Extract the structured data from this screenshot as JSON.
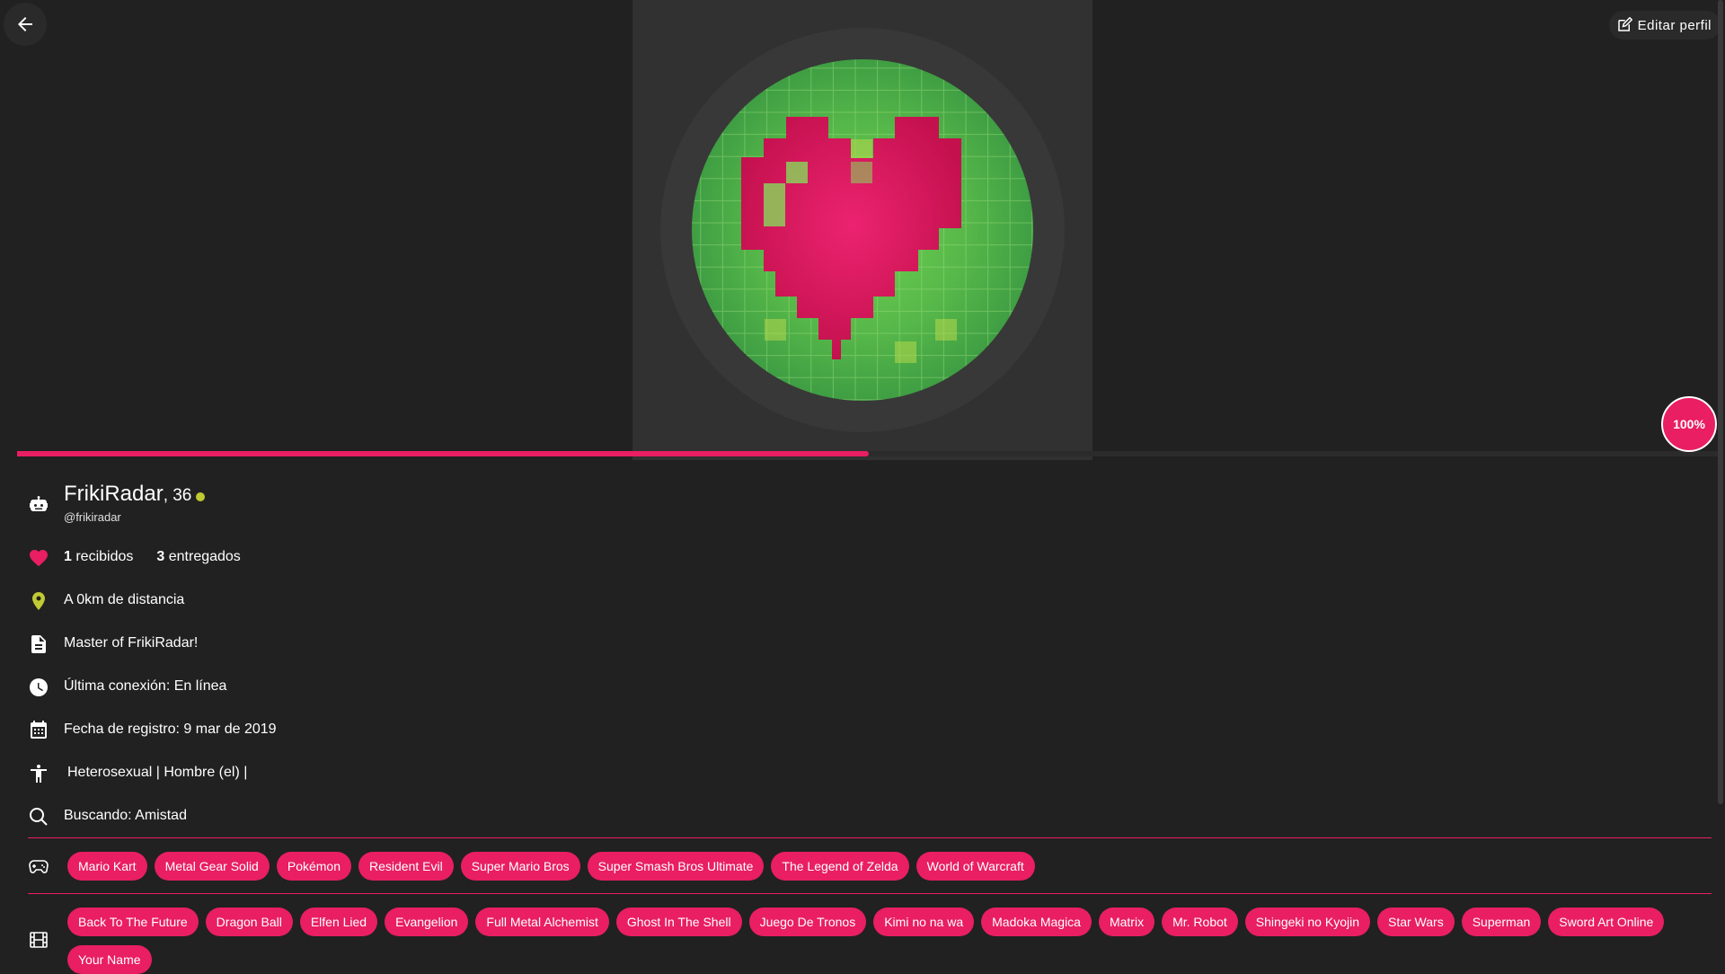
{
  "header": {
    "edit_label": "Editar perfil"
  },
  "profile": {
    "name": "FrikiRadar",
    "age_text": ", 36",
    "handle": "@frikiradar",
    "completion": "100%",
    "completion_value": 0.5
  },
  "stats": {
    "received_count": "1",
    "received_label": " recibidos",
    "given_count": "3",
    "given_label": " entregados"
  },
  "info": {
    "distance": "A 0km de distancia",
    "bio": "Master of FrikiRadar!",
    "last_connection": "Última conexión: En línea",
    "registered": "Fecha de registro: 9 mar de 2019",
    "identity": "Heterosexual |  Hombre (el) |",
    "looking_for": "Buscando: Amistad"
  },
  "games": [
    "Mario Kart",
    "Metal Gear Solid",
    "Pokémon",
    "Resident Evil",
    "Super Mario Bros",
    "Super Smash Bros Ultimate",
    "The Legend of Zelda",
    "World of Warcraft"
  ],
  "movies": [
    "Back To The Future",
    "Dragon Ball",
    "Elfen Lied",
    "Evangelion",
    "Full Metal Alchemist",
    "Ghost In The Shell",
    "Juego De Tronos",
    "Kimi no na wa",
    "Madoka Magica",
    "Matrix",
    "Mr. Robot",
    "Shingeki no Kyojin",
    "Star Wars",
    "Superman",
    "Sword Art Online",
    "Your Name"
  ],
  "colors": {
    "accent": "#e91e63",
    "online": "#c0ca33",
    "background": "#212121"
  }
}
